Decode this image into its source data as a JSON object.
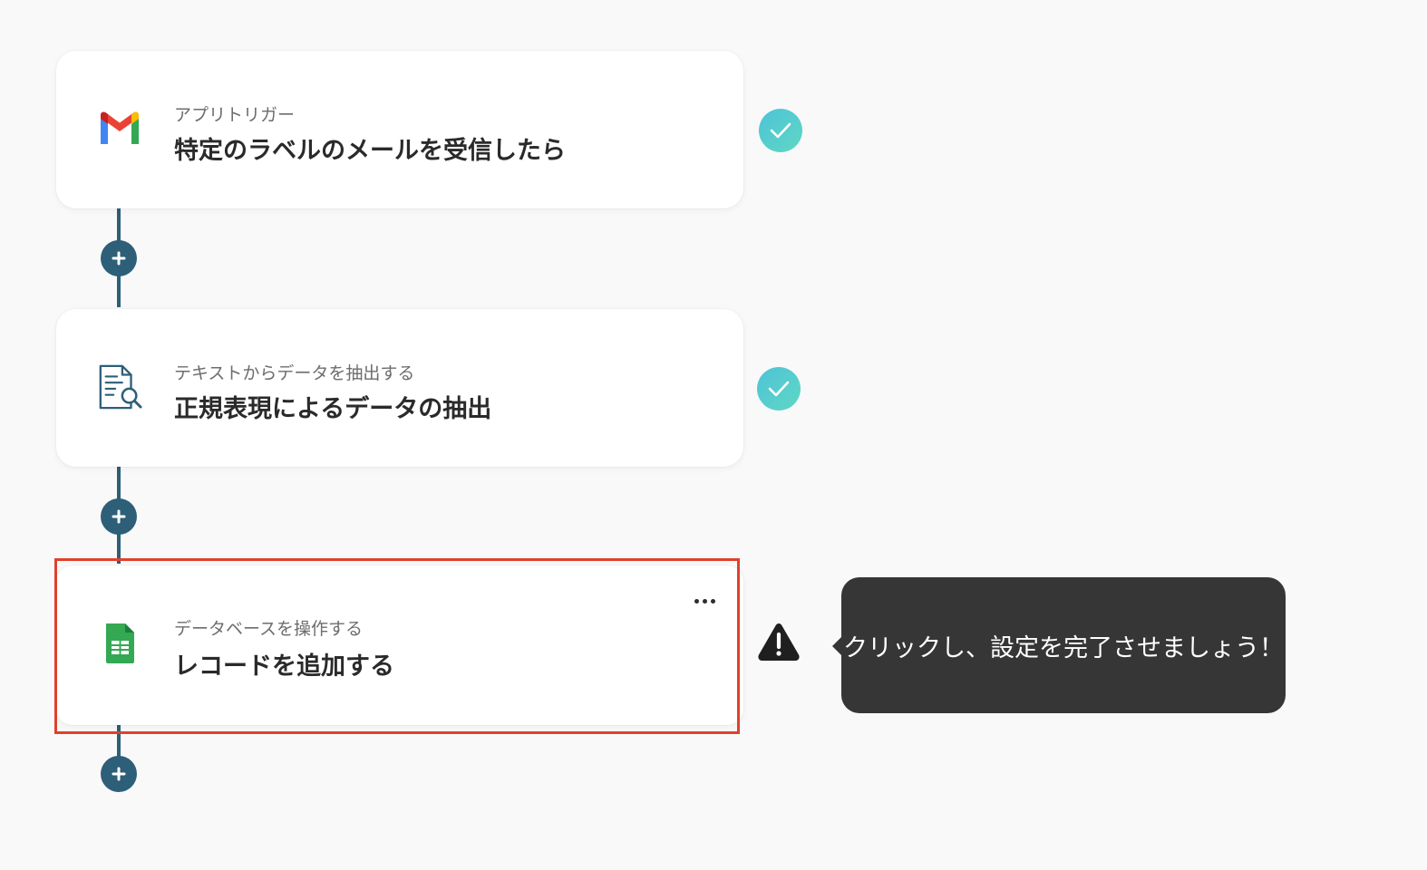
{
  "flow": {
    "steps": [
      {
        "subtitle": "アプリトリガー",
        "title": "特定のラベルのメールを受信したら",
        "icon": "gmail-icon",
        "status": "complete"
      },
      {
        "subtitle": "テキストからデータを抽出する",
        "title": "正規表現によるデータの抽出",
        "icon": "document-search-icon",
        "status": "complete"
      },
      {
        "subtitle": "データベースを操作する",
        "title": "レコードを追加する",
        "icon": "google-sheets-icon",
        "status": "warning"
      }
    ]
  },
  "tooltip": {
    "text": "クリックし、設定を完了させましょう！"
  },
  "colors": {
    "background": "#f9f9f9",
    "connector": "#2d5f78",
    "check_gradient_start": "#4ec3d8",
    "check_gradient_end": "#5fd7c3",
    "highlight": "#e0412c",
    "tooltip_bg": "#363636"
  }
}
